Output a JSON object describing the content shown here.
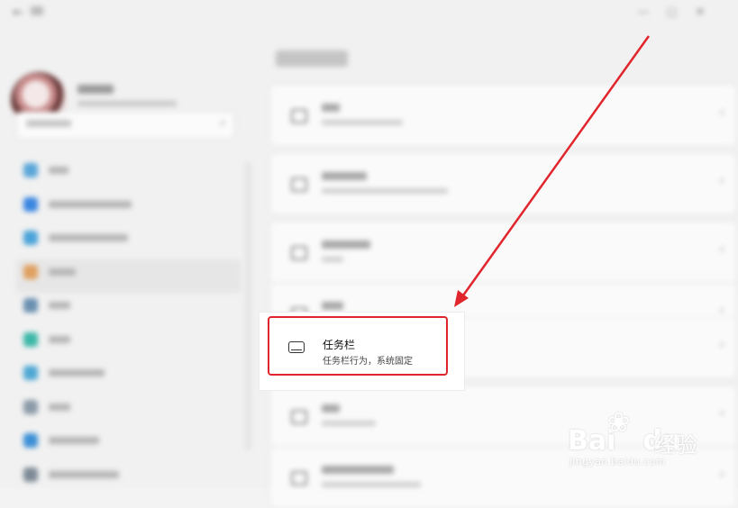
{
  "taskbar_item": {
    "title": "任务栏",
    "subtitle": "任务栏行为，系统固定",
    "icon": "taskbar-icon"
  },
  "annotation": {
    "arrow_color": "#e0262c",
    "box_color": "#e0262c"
  },
  "watermark": {
    "logo": "Bai",
    "logo_suffix": "du",
    "brand": "经验",
    "url": "jingyan.baidu.com"
  },
  "icons": {
    "back": "back-arrow-icon",
    "minimize": "minimize-icon",
    "maximize": "maximize-icon",
    "close": "close-icon",
    "search": "search-icon",
    "chevron": "chevron-right-icon"
  }
}
